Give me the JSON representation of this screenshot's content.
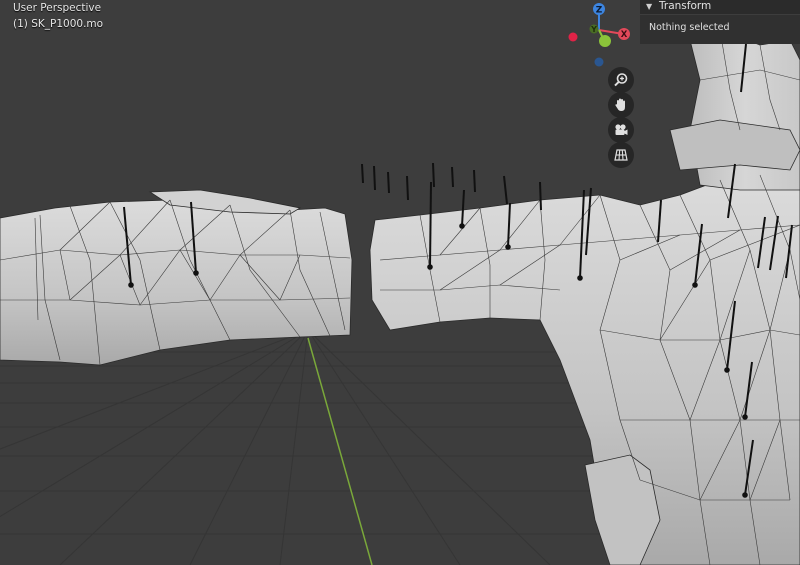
{
  "viewport": {
    "view_name": "User Perspective",
    "object_name": "(1) SK_P1000.mo"
  },
  "gizmo": {
    "z_label": "Z",
    "y_label": "Y",
    "x_label": "X",
    "colors": {
      "x": "#e2495a",
      "y": "#8bc33a",
      "z": "#3d85e0"
    }
  },
  "nav_buttons": [
    {
      "name": "zoom",
      "icon": "magnifier-plus-icon"
    },
    {
      "name": "pan",
      "icon": "hand-icon"
    },
    {
      "name": "camera",
      "icon": "camera-icon"
    },
    {
      "name": "projection",
      "icon": "grid-icon"
    }
  ],
  "transform_panel": {
    "title": "Transform",
    "message": "Nothing selected"
  },
  "colors": {
    "background": "#3d3d3d",
    "grid": "#333333",
    "mesh": "#c9c9c9",
    "wire": "#2a2a2a",
    "y_axis": "#7aa83a"
  }
}
